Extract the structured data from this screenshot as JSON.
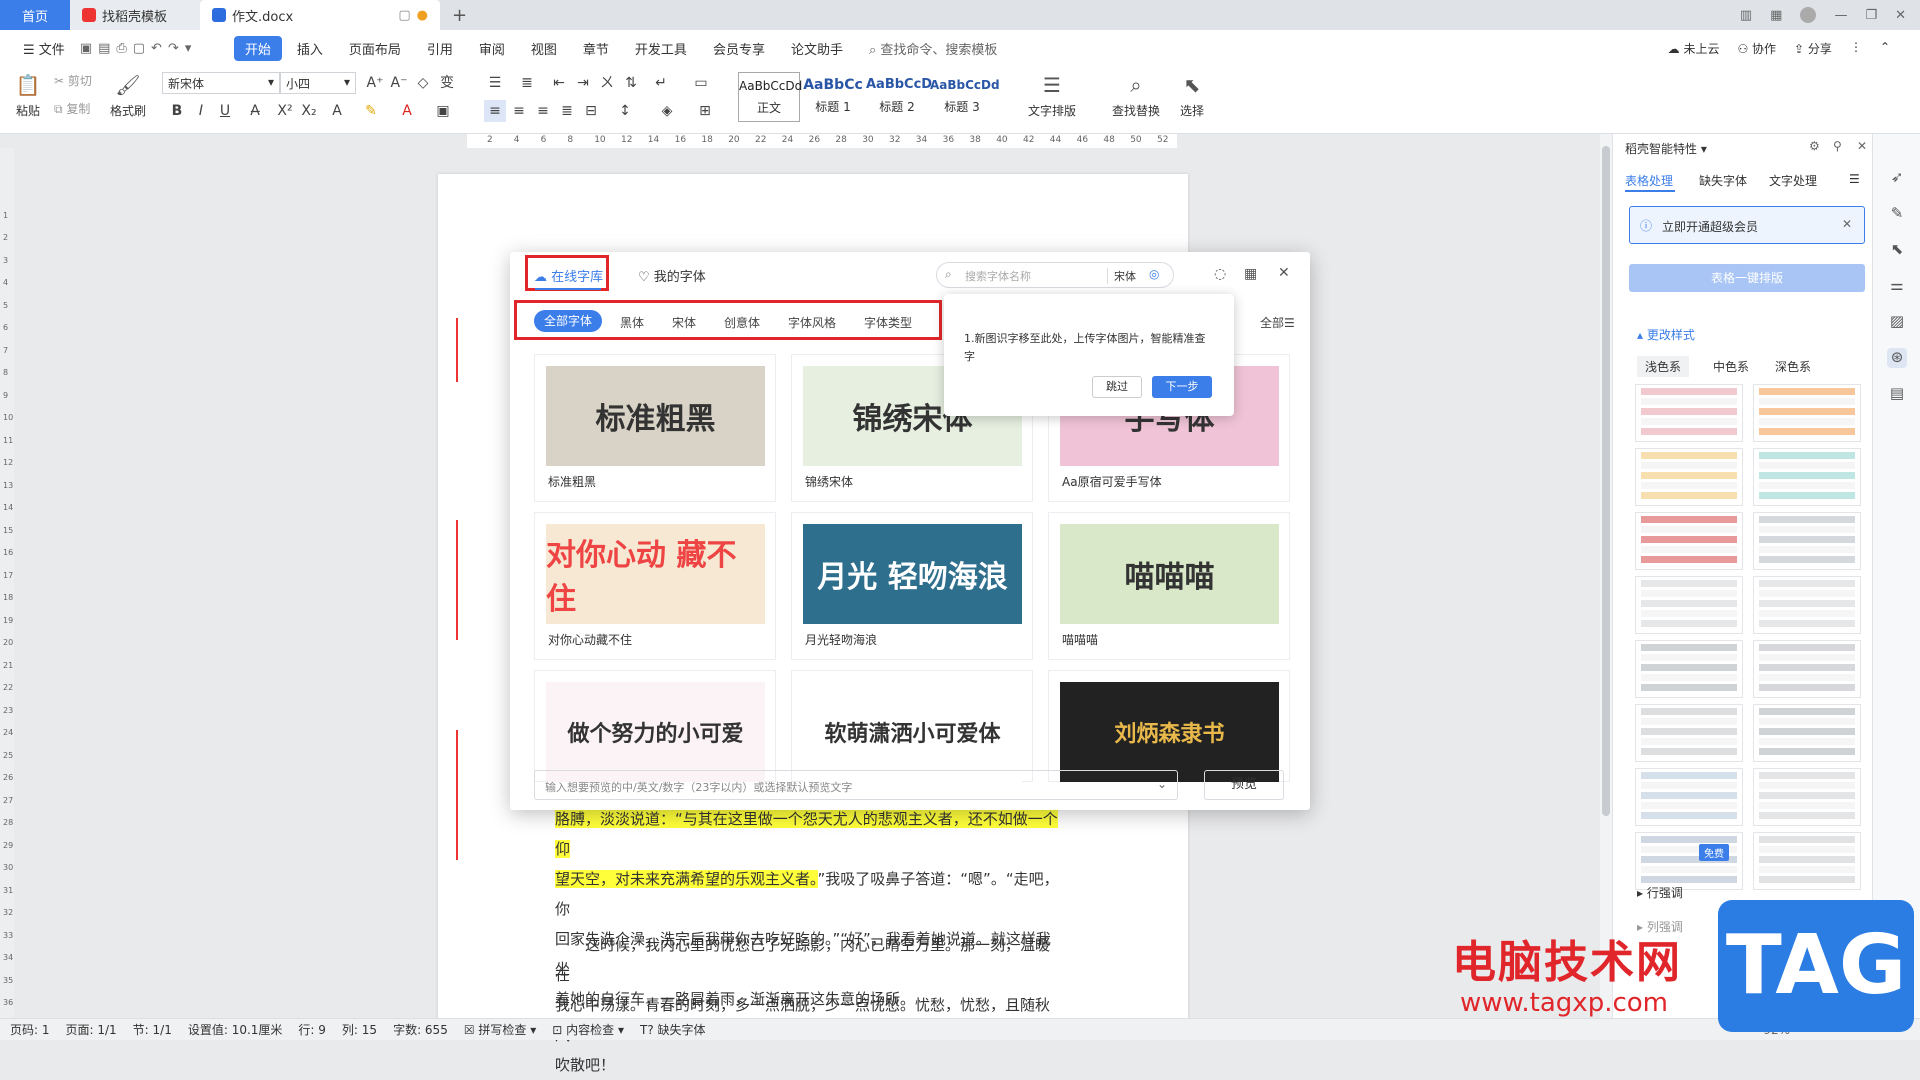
{
  "tabs": {
    "home": "首页",
    "t2": "找稻壳模板",
    "t3": "作文.docx"
  },
  "menu": {
    "file": "文件",
    "items": [
      "开始",
      "插入",
      "页面布局",
      "引用",
      "审阅",
      "视图",
      "章节",
      "开发工具",
      "会员专享",
      "论文助手"
    ],
    "search": "查找命令、搜索模板",
    "cloud": "未上云",
    "collab": "协作",
    "share": "分享"
  },
  "ribbon": {
    "paste": "粘贴",
    "cut": "剪切",
    "copy": "复制",
    "format_painter": "格式刷",
    "font": "新宋体",
    "size": "小四",
    "styles": [
      {
        "sample": "AaBbCcDd",
        "name": "正文"
      },
      {
        "sample": "AaBbCc",
        "name": "标题 1"
      },
      {
        "sample": "AaBbCcD",
        "name": "标题 2"
      },
      {
        "sample": "AaBbCcDd",
        "name": "标题 3"
      }
    ],
    "text_layout": "文字排版",
    "find_replace": "查找替换",
    "select": "选择"
  },
  "ruler": [
    "2",
    "4",
    "6",
    "8",
    "10",
    "12",
    "14",
    "16",
    "18",
    "20",
    "22",
    "24",
    "26",
    "28",
    "30",
    "32",
    "34",
    "36",
    "38",
    "40",
    "42",
    "44",
    "46",
    "48",
    "50",
    "52"
  ],
  "doc": {
    "p1a": "胳膊，淡淡说道：“与其在这里做一个怨天尤人的悲观主义者，还不如做一个仰",
    "p1b": "望天空，对未来充满希望的乐观主义者。",
    "p1c": "”我吸了吸鼻子答道：“嗯”。“走吧，你",
    "p1d": "回家先洗个澡，洗完后我带你去吃好吃的。”“好”，我看着她说道。就这样我坐",
    "p1e": "着她的自行车，一路冒着雨，渐渐离开这失意的场所。",
    "p2a": "这时候，我内心里的忧愁已了无踪影，内心已晴空万里。那一刻，温暖在",
    "p2b": "我心中荡漾。青春的时刻，多一点洒脱，少一点忧愁。忧愁，忧愁，且随秋风",
    "p2c": "吹散吧！"
  },
  "dialog": {
    "tab_online": "在线字库",
    "tab_mine": "我的字体",
    "search_placeholder": "搜索字体名称",
    "search_font": "宋体",
    "filters": [
      "全部字体",
      "黑体",
      "宋体",
      "创意体",
      "字体风格",
      "字体类型"
    ],
    "all": "全部",
    "tooltip_text": "1.新图识字移至此处，上传字体图片，智能精准查字",
    "skip": "跳过",
    "next": "下一步",
    "preview_placeholder": "输入想要预览的中/英文/数字（23字以内）或选择默认预览文字",
    "preview_btn": "预览",
    "cards": [
      {
        "img": "标准粗黑",
        "cap": "标准粗黑",
        "bg": "#d9d2c6"
      },
      {
        "img": "锦绣宋体",
        "cap": "锦绣宋体",
        "bg": "#e6efe0"
      },
      {
        "img": "手写体",
        "cap": "Aa原宿可爱手写体",
        "bg": "#f0c4d6"
      },
      {
        "img": "对你心动 藏不住",
        "cap": "对你心动藏不住",
        "bg": "#f6e8d3"
      },
      {
        "img": "月光 轻吻海浪",
        "cap": "月光轻吻海浪",
        "bg": "#2f6f8e"
      },
      {
        "img": "喵喵喵",
        "cap": "喵喵喵",
        "bg": "#d8e8c8"
      },
      {
        "img": "做个努力的小可爱",
        "cap": "",
        "bg": "#fbf3f6"
      },
      {
        "img": "软萌潇洒小可爱体",
        "cap": "",
        "bg": "#ffffff"
      },
      {
        "img": "刘炳森隶书",
        "cap": "",
        "bg": "#222222"
      }
    ]
  },
  "rpanel": {
    "title": "稻壳智能特性",
    "tabs": [
      "表格处理",
      "缺失字体",
      "文字处理"
    ],
    "vip": "立即开通超级会员",
    "onekey": "表格一键排版",
    "change_style": "更改样式",
    "color_tabs": [
      "浅色系",
      "中色系",
      "深色系"
    ],
    "free": "免费",
    "row_adjust": "行强调",
    "col_adjust": "列强调"
  },
  "status": {
    "page_num": "页码: 1",
    "pages": "页面: 1/1",
    "section": "节: 1/1",
    "setting": "设置值: 10.1厘米",
    "row": "行: 9",
    "col": "列: 15",
    "words": "字数: 655",
    "spell": "拼写检查",
    "content": "内容检查",
    "missing_font": "缺失字体",
    "zoom": "92%"
  },
  "watermark": {
    "text": "电脑技术网",
    "url": "www.tagxp.com",
    "tag": "TAG"
  }
}
